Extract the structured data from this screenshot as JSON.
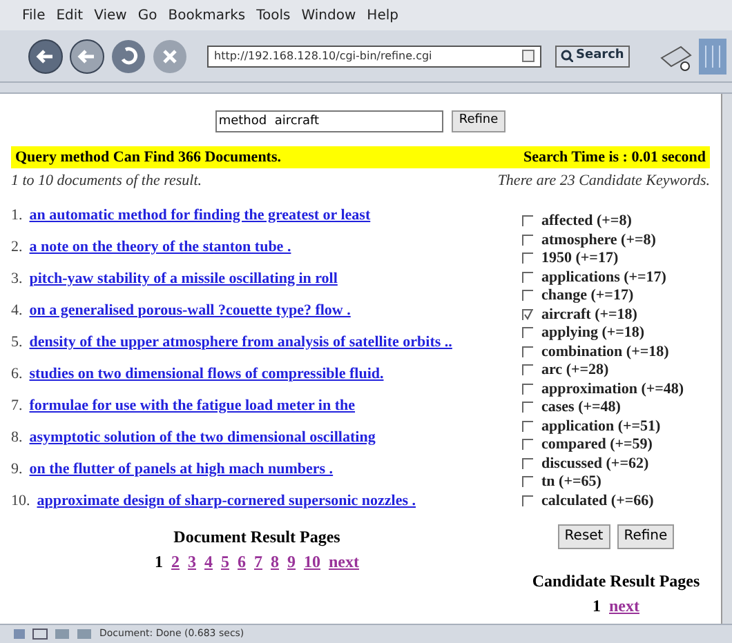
{
  "menu": [
    "File",
    "Edit",
    "View",
    "Go",
    "Bookmarks",
    "Tools",
    "Window",
    "Help"
  ],
  "address": "http://192.168.128.10/cgi-bin/refine.cgi",
  "search_button": "Search",
  "query_field": {
    "value": "method  aircraft"
  },
  "refine_button": "Refine",
  "banner": {
    "left": "Query method Can Find 366 Documents.",
    "right": "Search Time is : 0.01 second"
  },
  "results_caption": "1 to 10 documents of the result.",
  "keywords_caption": "There are 23 Candidate Keywords.",
  "results": [
    {
      "number": "1.",
      "title": "an automatic method for finding the greatest or least"
    },
    {
      "number": "2.",
      "title": "a note on the theory of the stanton tube ."
    },
    {
      "number": "3.",
      "title": "pitch-yaw stability of a missile oscillating in roll"
    },
    {
      "number": "4.",
      "title": "on a generalised porous-wall ?couette type? flow ."
    },
    {
      "number": "5.",
      "title": "density of the upper atmosphere from analysis of satellite orbits .."
    },
    {
      "number": "6.",
      "title": "studies on two dimensional flows of compressible fluid."
    },
    {
      "number": "7.",
      "title": "formulae for use with the fatigue load meter in the"
    },
    {
      "number": "8.",
      "title": "asymptotic solution of the two dimensional oscillating"
    },
    {
      "number": "9.",
      "title": "on the flutter of panels at high mach numbers ."
    },
    {
      "number": "10.",
      "title": "approximate design of sharp-cornered supersonic nozzles ."
    }
  ],
  "keywords": [
    {
      "label": "affected (+=8)",
      "checked": false
    },
    {
      "label": "atmosphere (+=8)",
      "checked": false
    },
    {
      "label": "1950 (+=17)",
      "checked": false
    },
    {
      "label": "applications (+=17)",
      "checked": false
    },
    {
      "label": "change (+=17)",
      "checked": false
    },
    {
      "label": "aircraft (+=18)",
      "checked": true
    },
    {
      "label": "applying (+=18)",
      "checked": false
    },
    {
      "label": "combination (+=18)",
      "checked": false
    },
    {
      "label": "arc (+=28)",
      "checked": false
    },
    {
      "label": "approximation (+=48)",
      "checked": false
    },
    {
      "label": "cases (+=48)",
      "checked": false
    },
    {
      "label": "application (+=51)",
      "checked": false
    },
    {
      "label": "compared (+=59)",
      "checked": false
    },
    {
      "label": "discussed (+=62)",
      "checked": false
    },
    {
      "label": "tn (+=65)",
      "checked": false
    },
    {
      "label": "calculated (+=66)",
      "checked": false
    }
  ],
  "keyword_buttons": [
    "Reset",
    "Refine"
  ],
  "document_pages": {
    "title": "Document Result Pages",
    "pages": [
      {
        "label": "1",
        "selected": true
      },
      {
        "label": "2",
        "selected": false
      },
      {
        "label": "3",
        "selected": false
      },
      {
        "label": "4",
        "selected": false
      },
      {
        "label": "5",
        "selected": false
      },
      {
        "label": "6",
        "selected": false
      },
      {
        "label": "7",
        "selected": false
      },
      {
        "label": "8",
        "selected": false
      },
      {
        "label": "9",
        "selected": false
      },
      {
        "label": "10",
        "selected": false
      },
      {
        "label": "next",
        "selected": false
      }
    ]
  },
  "candidate_pages": {
    "title": "Candidate Result Pages",
    "pages": [
      {
        "label": "1",
        "selected": true
      },
      {
        "label": "next",
        "selected": false
      }
    ]
  },
  "status_bar": "Document: Done (0.683 secs)"
}
